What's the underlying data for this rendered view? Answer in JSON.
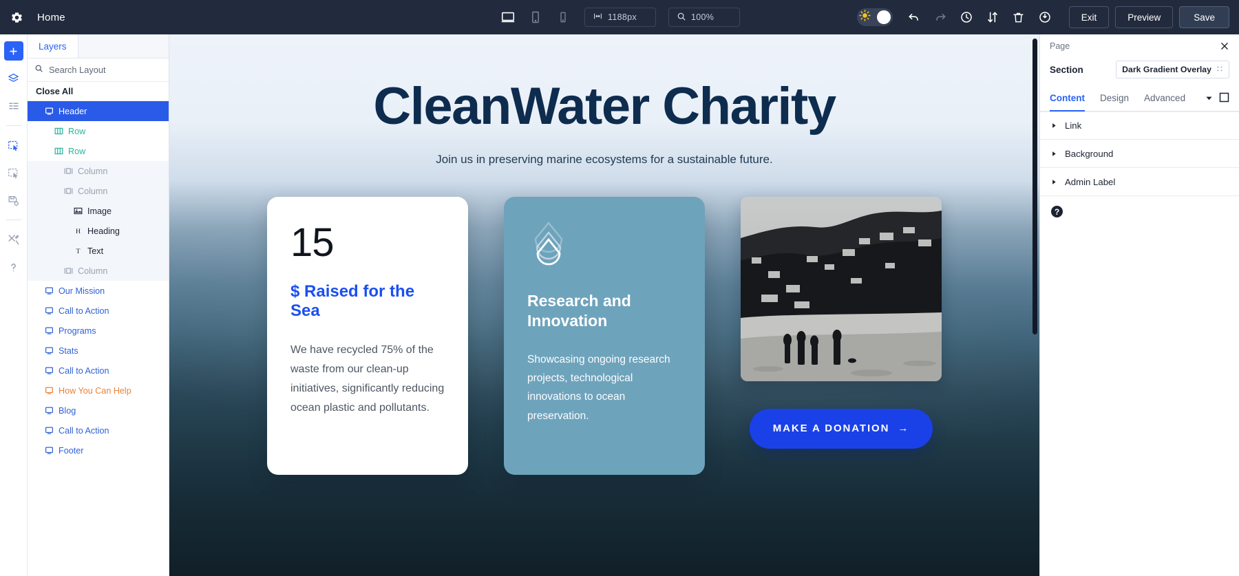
{
  "topbar": {
    "gear_icon": "gear-icon",
    "home_label": "Home",
    "devices": [
      {
        "name": "desktop",
        "icon": "desktop-icon",
        "active": true
      },
      {
        "name": "tablet",
        "icon": "tablet-icon",
        "active": false
      },
      {
        "name": "phone",
        "icon": "phone-icon",
        "active": false
      }
    ],
    "width_icon": "width-arrows-icon",
    "width_value": "1188px",
    "zoom_icon": "magnifier-icon",
    "zoom_value": "100%",
    "theme_toggle_icon": "sun-icon",
    "icons": [
      {
        "name": "undo-icon"
      },
      {
        "name": "redo-icon"
      },
      {
        "name": "history-clock-icon"
      },
      {
        "name": "sort-updown-icon"
      },
      {
        "name": "trash-icon"
      },
      {
        "name": "power-icon"
      }
    ],
    "exit_label": "Exit",
    "preview_label": "Preview",
    "save_label": "Save"
  },
  "rail": {
    "items": [
      {
        "name": "add-icon",
        "style": "primary"
      },
      {
        "name": "layers-icon",
        "style": "blue"
      },
      {
        "name": "list-icon",
        "style": "grey"
      },
      {
        "name": "select-element-icon",
        "style": "blue"
      },
      {
        "name": "clone-element-icon",
        "style": "grey"
      },
      {
        "name": "save-layout-icon",
        "style": "grey"
      },
      {
        "name": "tools-icon",
        "style": "grey"
      },
      {
        "name": "help-icon",
        "style": "grey"
      }
    ]
  },
  "layers": {
    "tab_label": "Layers",
    "search_placeholder": "Search Layout",
    "search_value": "",
    "search_icon": "search-icon",
    "filter_icon": "filter-icon",
    "close_all_label": "Close All",
    "tree": [
      {
        "label": "Header",
        "icon": "section-icon",
        "indent": 1,
        "style": "sel"
      },
      {
        "label": "Row",
        "icon": "row-icon",
        "indent": 2,
        "style": "green"
      },
      {
        "label": "Row",
        "icon": "row-icon",
        "indent": 2,
        "style": "green"
      },
      {
        "label": "Column",
        "icon": "column-icon",
        "indent": 3,
        "style": "grey"
      },
      {
        "label": "Column",
        "icon": "column-icon",
        "indent": 3,
        "style": "grey"
      },
      {
        "label": "Image",
        "icon": "image-icon",
        "indent": 4,
        "style": "dark"
      },
      {
        "label": "Heading",
        "icon": "heading-icon",
        "indent": 4,
        "style": "dark"
      },
      {
        "label": "Text",
        "icon": "text-icon",
        "indent": 4,
        "style": "dark"
      },
      {
        "label": "Column",
        "icon": "column-icon",
        "indent": 3,
        "style": "grey"
      },
      {
        "label": "Our Mission",
        "icon": "section-icon",
        "indent": 1,
        "style": "blue"
      },
      {
        "label": "Call to Action",
        "icon": "section-icon",
        "indent": 1,
        "style": "blue"
      },
      {
        "label": "Programs",
        "icon": "section-icon",
        "indent": 1,
        "style": "blue"
      },
      {
        "label": "Stats",
        "icon": "section-icon",
        "indent": 1,
        "style": "blue"
      },
      {
        "label": "Call to Action",
        "icon": "section-icon",
        "indent": 1,
        "style": "blue"
      },
      {
        "label": "How You Can Help",
        "icon": "section-icon",
        "indent": 1,
        "style": "orange"
      },
      {
        "label": "Blog",
        "icon": "section-icon",
        "indent": 1,
        "style": "blue"
      },
      {
        "label": "Call to Action",
        "icon": "section-icon",
        "indent": 1,
        "style": "blue"
      },
      {
        "label": "Footer",
        "icon": "section-icon",
        "indent": 1,
        "style": "blue"
      }
    ]
  },
  "canvas": {
    "hero": {
      "title": "CleanWater Charity",
      "subtitle": "Join us in preserving marine ecosystems for a sustainable future."
    },
    "card_white": {
      "number": "15",
      "title": "$ Raised for the Sea",
      "body": "We have recycled 75% of the waste from our clean-up initiatives, significantly reducing ocean plastic and pollutants."
    },
    "card_blue": {
      "icon": "water-drop-layers-icon",
      "title": "Research and Innovation",
      "body": "Showcasing ongoing research projects, technological innovations to ocean preservation."
    },
    "photo": {
      "name": "beach-hillside-photo",
      "alt": "Grayscale photo of people silhouetted on a beach with a hillside town"
    },
    "donate_label": "MAKE A DONATION",
    "donate_arrow": "→"
  },
  "rpanel": {
    "title": "Page",
    "close_icon": "close-icon",
    "section_label": "Section",
    "section_value": "Dark Gradient Overlay",
    "section_chip_icon": "drag-handle-icon",
    "tabs": [
      {
        "label": "Content",
        "active": true
      },
      {
        "label": "Design",
        "active": false
      },
      {
        "label": "Advanced",
        "active": false
      }
    ],
    "tab_caret_icon": "chevron-down-icon",
    "tab_square_icon": "square-icon",
    "accordions": [
      {
        "label": "Link",
        "icon": "triangle-right-icon"
      },
      {
        "label": "Background",
        "icon": "triangle-right-icon"
      },
      {
        "label": "Admin Label",
        "icon": "triangle-right-icon"
      }
    ],
    "help_icon": "question-circle-icon",
    "help_glyph": "?"
  },
  "colors": {
    "topbar_bg": "#222b3d",
    "accent_blue": "#2a63f6",
    "selected_layer": "#2a5ae8",
    "orange_layer": "#e8823a",
    "green_layer": "#2bb39b",
    "hero_navy": "#0e2c4e",
    "card_blue": "#6ea3bc",
    "donate_blue": "#1a41e8"
  }
}
